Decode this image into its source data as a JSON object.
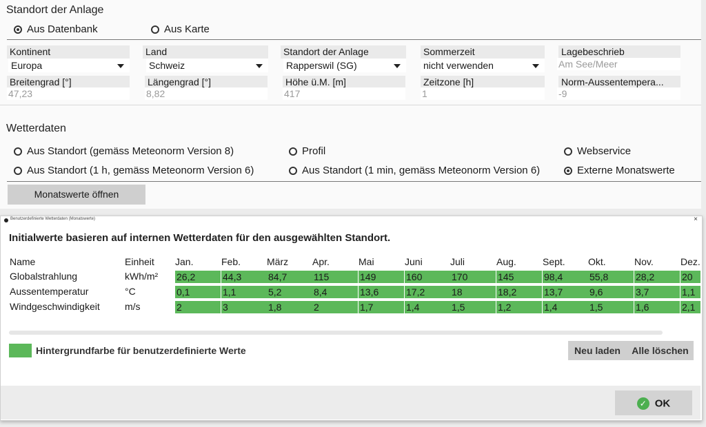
{
  "location": {
    "title": "Standort der Anlage",
    "source_options": [
      {
        "label": "Aus Datenbank",
        "checked": true
      },
      {
        "label": "Aus Karte",
        "checked": false
      }
    ],
    "fields_row1": [
      {
        "label": "Kontinent",
        "value": "Europa",
        "type": "dropdown"
      },
      {
        "label": "Land",
        "value": "Schweiz",
        "type": "dropdown"
      },
      {
        "label": "Standort der Anlage",
        "value": "Rapperswil (SG)",
        "type": "dropdown"
      },
      {
        "label": "Sommerzeit",
        "value": "nicht verwenden",
        "type": "dropdown"
      },
      {
        "label": "Lagebeschrieb",
        "value": "Am See/Meer",
        "type": "readonly"
      }
    ],
    "fields_row2": [
      {
        "label": "Breitengrad [°]",
        "value": "47,23"
      },
      {
        "label": "Längengrad [°]",
        "value": "8,82"
      },
      {
        "label": "Höhe ü.M. [m]",
        "value": "417"
      },
      {
        "label": "Zeitzone [h]",
        "value": "1"
      },
      {
        "label": "Norm-Aussentempera...",
        "value": "-9"
      }
    ]
  },
  "weather": {
    "title": "Wetterdaten",
    "options": [
      {
        "label": "Aus Standort (gemäss Meteonorm Version 8)",
        "checked": false
      },
      {
        "label": "Profil",
        "checked": false
      },
      {
        "label": "Webservice",
        "checked": false
      },
      {
        "label": "Aus Standort (1 h, gemäss Meteonorm Version 6)",
        "checked": false
      },
      {
        "label": "Aus Standort (1 min, gemäss Meteonorm Version 6)",
        "checked": false
      },
      {
        "label": "Externe Monatswerte",
        "checked": true
      }
    ],
    "open_button": "Monatswerte öffnen"
  },
  "dialog": {
    "title": "Benutzerdefinierte Wetterdaten (Monatswerte)",
    "heading": "Initialwerte basieren auf internen Wetterdaten für den ausgewählten Standort.",
    "columns": {
      "name": "Name",
      "unit": "Einheit"
    },
    "months": [
      "Jan.",
      "Feb.",
      "März",
      "Apr.",
      "Mai",
      "Juni",
      "Juli",
      "Aug.",
      "Sept.",
      "Okt.",
      "Nov.",
      "Dez."
    ],
    "rows": [
      {
        "name": "Globalstrahlung",
        "unit": "kWh/m²",
        "values": [
          "26,2",
          "44,3",
          "84,7",
          "115",
          "149",
          "160",
          "170",
          "145",
          "98,4",
          "55,8",
          "28,2",
          "20"
        ]
      },
      {
        "name": "Aussentemperatur",
        "unit": "°C",
        "values": [
          "0,1",
          "1,1",
          "5,2",
          "8,4",
          "13,6",
          "17,2",
          "18",
          "18,2",
          "13,7",
          "9,6",
          "3,7",
          "1,1"
        ]
      },
      {
        "name": "Windgeschwindigkeit",
        "unit": "m/s",
        "values": [
          "2",
          "3",
          "1,8",
          "2",
          "1,7",
          "1,4",
          "1,5",
          "1,2",
          "1,4",
          "1,5",
          "1,6",
          "2,1"
        ]
      }
    ],
    "legend_label": "Hintergrundfarbe für benutzerdefinierte Werte",
    "legend_color": "#5cb85a",
    "reload_button": "Neu laden",
    "clear_button": "Alle löschen",
    "ok_button": "OK",
    "ok_icon_color": "#4caf50"
  }
}
